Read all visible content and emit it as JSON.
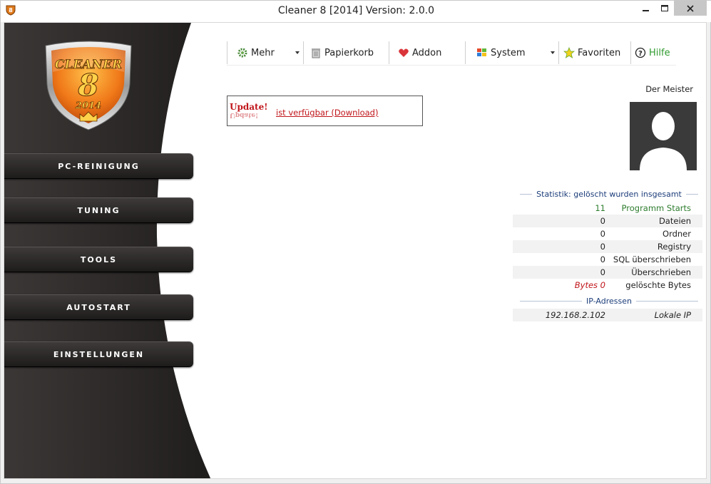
{
  "window": {
    "title": "Cleaner 8 [2014] Version: 2.0.0",
    "app_icon": "cleaner-app-icon"
  },
  "logo": {
    "text_top": "CLEANER",
    "text_mid": "8",
    "text_year": "2014"
  },
  "sidebar": {
    "items": [
      {
        "label": "PC-REINIGUNG"
      },
      {
        "label": "TUNING"
      },
      {
        "label": "TOOLS"
      },
      {
        "label": "AUTOSTART"
      },
      {
        "label": "EINSTELLUNGEN"
      }
    ]
  },
  "toolbar": {
    "mehr": "Mehr",
    "papierkorb": "Papierkorb",
    "addon": "Addon",
    "system": "System",
    "favoriten": "Favoriten",
    "hilfe": "Hilfe",
    "hilfe_color": "#2e9a2e"
  },
  "update": {
    "badge": "Update!",
    "link": "ist verfügbar (Download)"
  },
  "user": {
    "name": "Der Meister"
  },
  "stats": {
    "header": "Statistik: gelöscht wurden insgesamt",
    "rows": [
      {
        "value": "11",
        "label": "Programm Starts",
        "color": "#2e7d2e"
      },
      {
        "value": "0",
        "label": "Dateien"
      },
      {
        "value": "0",
        "label": "Ordner"
      },
      {
        "value": "0",
        "label": "Registry"
      },
      {
        "value": "0",
        "label": "SQL überschrieben"
      },
      {
        "value": "0",
        "label": "Überschrieben"
      },
      {
        "value": "Bytes 0",
        "label": "gelöschte Bytes",
        "value_color": "#c0151a"
      }
    ]
  },
  "ip": {
    "header": "IP-Adressen",
    "address": "192.168.2.102",
    "label": "Lokale IP"
  }
}
